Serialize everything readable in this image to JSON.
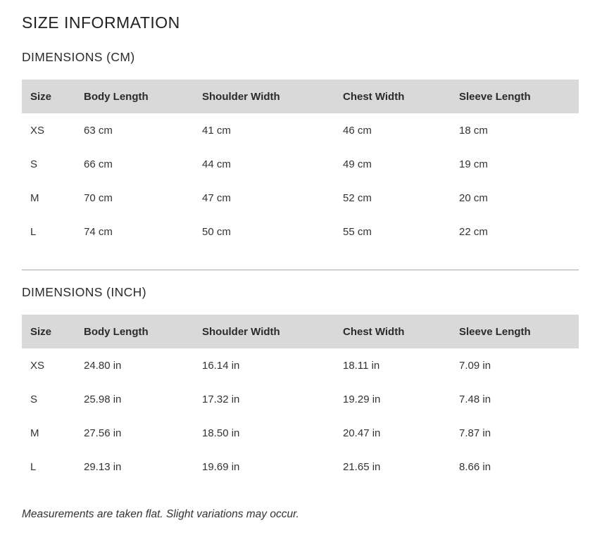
{
  "page_title": "SIZE INFORMATION",
  "sections": [
    {
      "title": "DIMENSIONS (CM)",
      "headers": [
        "Size",
        "Body Length",
        "Shoulder Width",
        "Chest Width",
        "Sleeve Length"
      ],
      "rows": [
        [
          "XS",
          "63 cm",
          "41 cm",
          "46 cm",
          "18 cm"
        ],
        [
          "S",
          "66 cm",
          "44 cm",
          "49 cm",
          "19 cm"
        ],
        [
          "M",
          "70 cm",
          "47 cm",
          "52 cm",
          "20 cm"
        ],
        [
          "L",
          "74 cm",
          "50 cm",
          "55 cm",
          "22 cm"
        ]
      ]
    },
    {
      "title": "DIMENSIONS (INCH)",
      "headers": [
        "Size",
        "Body Length",
        "Shoulder Width",
        "Chest Width",
        "Sleeve Length"
      ],
      "rows": [
        [
          "XS",
          "24.80 in",
          "16.14 in",
          "18.11 in",
          "7.09 in"
        ],
        [
          "S",
          "25.98 in",
          "17.32 in",
          "19.29 in",
          "7.48 in"
        ],
        [
          "M",
          "27.56 in",
          "18.50 in",
          "20.47 in",
          "7.87 in"
        ],
        [
          "L",
          "29.13 in",
          "19.69 in",
          "21.65 in",
          "8.66 in"
        ]
      ]
    }
  ],
  "note": "Measurements are taken flat. Slight variations may occur.",
  "colors": {
    "header_background": "#d9d9d9",
    "divider": "#a8a8a8",
    "text": "#2b2b2b"
  }
}
